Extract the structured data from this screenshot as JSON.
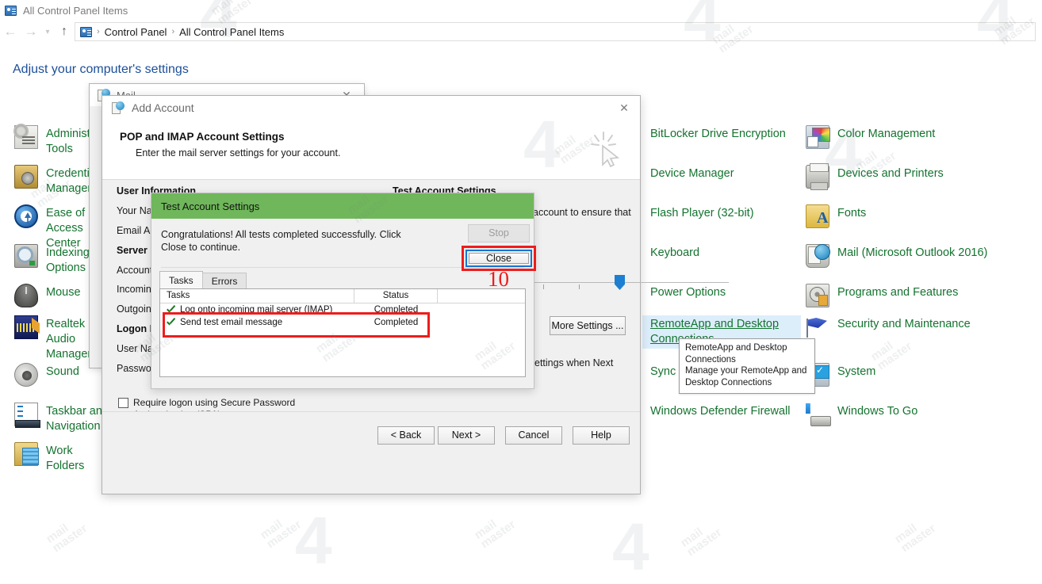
{
  "explorer": {
    "titlebar": {
      "icon": "control-panel-icon",
      "label": "All Control Panel Items"
    },
    "nav": {
      "back_icon": "arrow-left-icon",
      "forward_icon": "arrow-right-icon",
      "recent_icon": "chevron-down-icon",
      "up_icon": "arrow-up-icon",
      "address_icon": "control-panel-icon",
      "breadcrumbs": [
        "Control Panel",
        "All Control Panel Items"
      ],
      "separator": "›"
    },
    "heading": "Adjust your computer's settings"
  },
  "control_panel": {
    "items": [
      {
        "label": "Administrative Tools",
        "icon": "administrative-tools-icon",
        "col": 0,
        "row": 0
      },
      {
        "label": "Credential Manager",
        "icon": "credential-manager-icon",
        "col": 0,
        "row": 1
      },
      {
        "label": "Ease of Access Center",
        "icon": "ease-of-access-icon",
        "col": 0,
        "row": 2
      },
      {
        "label": "Indexing Options",
        "icon": "indexing-options-icon",
        "col": 0,
        "row": 3
      },
      {
        "label": "Mouse",
        "icon": "mouse-icon",
        "col": 0,
        "row": 4
      },
      {
        "label": "Realtek HD Audio Manager",
        "icon": "realtek-audio-icon",
        "col": 0,
        "row": 5
      },
      {
        "label": "Sound",
        "icon": "sound-icon",
        "col": 0,
        "row": 6
      },
      {
        "label": "Taskbar and Navigation",
        "icon": "taskbar-navigation-icon",
        "col": 0,
        "row": 7
      },
      {
        "label": "Work Folders",
        "icon": "work-folders-icon",
        "col": 0,
        "row": 8
      },
      {
        "label": "BitLocker Drive Encryption",
        "icon": "bitlocker-icon",
        "col": 2,
        "row": 0
      },
      {
        "label": "Device Manager",
        "icon": "device-manager-icon",
        "col": 2,
        "row": 1
      },
      {
        "label": "Flash Player (32-bit)",
        "icon": "flash-player-icon",
        "col": 2,
        "row": 2
      },
      {
        "label": "Keyboard",
        "icon": "keyboard-icon",
        "col": 2,
        "row": 3
      },
      {
        "label": "Power Options",
        "icon": "power-options-icon",
        "col": 2,
        "row": 4
      },
      {
        "label": "RemoteApp and Desktop Connections",
        "icon": "remoteapp-icon",
        "col": 2,
        "row": 5,
        "selected": true
      },
      {
        "label": "Sync Center",
        "icon": "sync-center-icon",
        "col": 2,
        "row": 6
      },
      {
        "label": "Windows Defender Firewall",
        "icon": "windows-defender-firewall-icon",
        "col": 2,
        "row": 7
      },
      {
        "label": "Color Management",
        "icon": "color-management-icon",
        "col": 3,
        "row": 0
      },
      {
        "label": "Devices and Printers",
        "icon": "devices-and-printers-icon",
        "col": 3,
        "row": 1
      },
      {
        "label": "Fonts",
        "icon": "fonts-icon",
        "col": 3,
        "row": 2
      },
      {
        "label": "Mail (Microsoft Outlook 2016)",
        "icon": "mail-icon",
        "col": 3,
        "row": 3
      },
      {
        "label": "Programs and Features",
        "icon": "programs-and-features-icon",
        "col": 3,
        "row": 4
      },
      {
        "label": "Security and Maintenance",
        "icon": "security-and-maintenance-icon",
        "col": 3,
        "row": 5
      },
      {
        "label": "System",
        "icon": "system-icon",
        "col": 3,
        "row": 6
      },
      {
        "label": "Windows To Go",
        "icon": "windows-to-go-icon",
        "col": 3,
        "row": 7
      }
    ],
    "tooltip": {
      "title": "RemoteApp and Desktop Connections",
      "description": "Manage your RemoteApp and Desktop Connections"
    },
    "link_color": "#14732f",
    "selection_color": "#ddeefb"
  },
  "mail_dialog": {
    "title": "Mail",
    "icon": "mail-icon",
    "close_icon": "close-icon"
  },
  "add_account": {
    "title": "Add Account",
    "icon": "mail-icon",
    "close_icon": "close-icon",
    "header_title": "POP and IMAP Account Settings",
    "header_subtitle": "Enter the mail server settings for your account.",
    "header_icon": "cursor-sparkle-icon",
    "sections": {
      "user_information": "User Information",
      "server_information": "Server Information",
      "logon_information": "Logon Information",
      "test_account_settings": "Test Account Settings"
    },
    "labels": {
      "your_name": "Your Name:",
      "email_address": "Email Address:",
      "account_type": "Account Type:",
      "incoming_mail_server": "Incoming mail server:",
      "outgoing_mail_server": "Outgoing mail server (SMTP):",
      "user_name": "User Name:",
      "password": "Password:"
    },
    "test_note": "account to ensure that",
    "test_note2": "ettings when Next",
    "spa_checkbox": "Require logon using Secure Password Authentication (SPA)",
    "spa_checked": false,
    "more_settings": "More Settings ...",
    "buttons": {
      "back": "< Back",
      "next": "Next >",
      "cancel": "Cancel",
      "help": "Help"
    }
  },
  "test_dialog": {
    "title": "Test Account Settings",
    "title_bg": "#6fb75a",
    "message": "Congratulations! All tests completed successfully. Click Close to continue.",
    "stop_button": "Stop",
    "stop_disabled": true,
    "close_button": "Close",
    "tabs": [
      {
        "label": "Tasks",
        "active": true
      },
      {
        "label": "Errors",
        "active": false
      }
    ],
    "table": {
      "headers": [
        "Tasks",
        "Status",
        ""
      ],
      "rows": [
        {
          "icon": "green-check-icon",
          "task": "Log onto incoming mail server (IMAP)",
          "status": "Completed"
        },
        {
          "icon": "green-check-icon",
          "task": "Send test email message",
          "status": "Completed"
        }
      ]
    },
    "highlight_color": "#ee1c1c",
    "focus_color": "#1675d1"
  },
  "annotation": {
    "step_number": "10",
    "color": "#ee1c1c"
  },
  "watermark": {
    "text": "mail\nmaster",
    "logo": "4"
  }
}
